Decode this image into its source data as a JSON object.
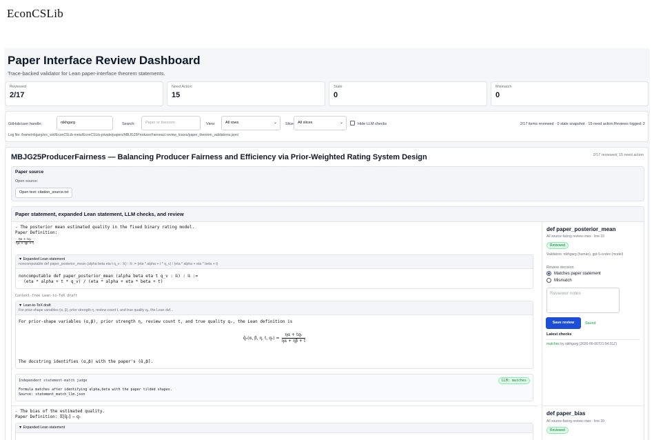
{
  "brand": "EconCSLib",
  "title": "Paper Interface Review Dashboard",
  "subtitle": "Trace-backed validator for Lean paper-interface theorem statements.",
  "stats": [
    {
      "label": "Reviewed",
      "value": "2/17"
    },
    {
      "label": "Need Action",
      "value": "15"
    },
    {
      "label": "Stale",
      "value": "0"
    },
    {
      "label": "Mismatch",
      "value": "0"
    }
  ],
  "filters": {
    "handle_label": "GitHub/user handle:",
    "handle_value": "nikhgarg",
    "search_label": "Search:",
    "search_placeholder": "Paper or theorem",
    "view_label": "View:",
    "view_value": "All rows",
    "slice_label": "Slice:",
    "slice_value": "All slices",
    "hide_llm": "Hide LLM checks",
    "summary": "2/17 items reviewed · 0 stale snapshot · 15 need action   Reviews logged: 2",
    "logfile": "Log file: /home/nkgarg/src_wsl/EconCSLib-meta/EconCSLib-private/papers/MBJG25ProducerFairness/.review_traces/paper_theorem_validations.jsonl"
  },
  "paper": {
    "title": "MBJG25ProducerFairness — Balancing Producer Fairness and Efficiency via Prior-Weighted Rating System Design",
    "meta": "2/17 reviewed; 15 need action",
    "source_heading": "Paper source",
    "open_source": "Open source:",
    "open_text": "Open text: citation_source.txt",
    "section_heading": "Paper statement, expanded Lean statement, LLM checks, and review"
  },
  "row1": {
    "desc": "- The posterior mean estimated quality in the fixed binary rating model.",
    "paper_def": "Paper Definition:",
    "expanded_label": "▼ Expanded Lean statement",
    "expanded_summary": "noncomputable def paper_posterior_mean (alpha beta eta t q_v : ℝ) : ℝ := (eta * alpha + t * q_v) / (eta * alpha + eta * beta + t)",
    "lean_code_1": "noncomputable def paper_posterior_mean (alpha beta eta t q_v : ℝ) : ℝ :=",
    "lean_code_2": "  (eta * alpha + t * q_v) / (eta * alpha + eta * beta + t)",
    "cf_label": "Context-free Lean-to-TeX draft",
    "tex_label": "▼ Lean-to-TeX draft",
    "tex_summary": "For prior-shape variables (α, β), prior strength η, review count t, and true quality qᵥ, the Lean def...",
    "tex_body": "For prior-shape variables (α,β), prior strength η, review count t, and true quality qᵥ, the Lean definition is",
    "tex_formula_lhs": "q̂ᵥ(α, β, η, t, qᵥ) =",
    "tex_num": "ηα + tqᵥ",
    "tex_den": "ηα + ηβ + t",
    "docstring": "The docstring identifies (α,β) with the paper's (ᾱ,β̄).",
    "judge_label": "Independent statement-match judge",
    "judge_badge": "LLM: matches",
    "judge_text_1": "Formula matches after identifying alpha,beta with the paper tilded shapes.",
    "judge_text_2": "Source: statement_match_llm.json",
    "side_title": "def paper_posterior_mean",
    "side_sub": "All source-facing review rows · line 33",
    "side_badge": "Reviewed",
    "validators": "Validators: nikhgarg (human), gpt-5-codex (model)",
    "decision_label": "Review decision",
    "opt1": "Matches paper statement",
    "opt2": "Mismatch",
    "notes_placeholder": "Reviewer notes",
    "save": "Save review",
    "saved": "Saved",
    "latest": "Latest checks",
    "latest_link": "matches",
    "latest_rest": " by nikhgarg (2026-06-06T21:54:31Z)"
  },
  "row2": {
    "desc": "- The bias of the estimated quality.",
    "paper_def": "Paper Definition:",
    "formula": "E[q̂ᵥ] − qᵥ",
    "expanded_label": "▼ Expanded Lean statement",
    "side_title": "def paper_bias",
    "side_sub": "All source-facing review rows · line 39",
    "side_badge": "Reviewed"
  }
}
